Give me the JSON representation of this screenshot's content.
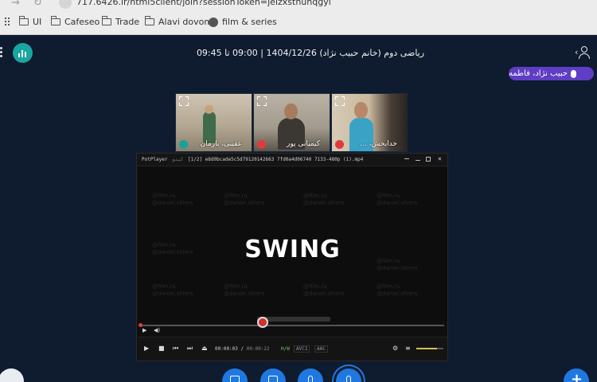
{
  "browser": {
    "url": "717.6426.ir/html5client/join?sessionToken=jelzxsthuhqgyi",
    "bookmarks": [
      "UI",
      "Cafeseo",
      "Trade",
      "Alavi dovom",
      "film & series"
    ]
  },
  "header": {
    "session_title": "ریاضی دوم (خانم حبیب نژاد) 1404/12/26 | 09:00 تا 09:45"
  },
  "speaker": {
    "name": "حبیب نژاد، فاطمه"
  },
  "tiles": [
    {
      "name": "عقیبی، بارمان",
      "badge_color": "#17a398"
    },
    {
      "name": "کیمیانی پور",
      "badge_color": "#e03b3b"
    },
    {
      "name": "خدابخش، ...",
      "badge_color": "#e03b3b"
    }
  ],
  "player": {
    "app": "PotPlayer",
    "menu": "کینو",
    "file": "[1/2] e8d0bcade5c5d79120142663 7fd0a4d06740 7133-480p (1).mp4",
    "title_text": "SWING",
    "watermark_lines": [
      "@film.ru",
      "@daniel.shiers"
    ],
    "time_current": "00:00:03",
    "time_total": "00:00:22",
    "tags": [
      "H/W",
      "AVC1",
      "AAC"
    ],
    "volume_fraction": 0.75
  },
  "colors": {
    "background": "#0f1b2e",
    "speaker_pill": "#5f3dc4",
    "logo": "#1aa6a0",
    "fab_blue": "#1f78e0"
  }
}
